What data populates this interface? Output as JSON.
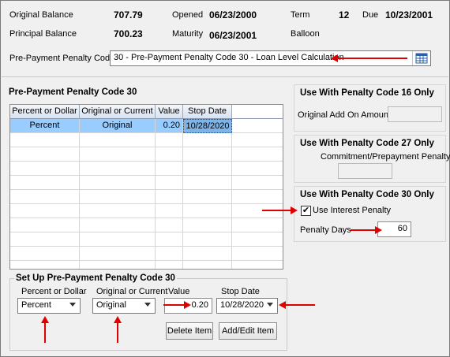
{
  "summary": {
    "original_balance_label": "Original Balance",
    "original_balance_value": "707.79",
    "principal_balance_label": "Principal Balance",
    "principal_balance_value": "700.23",
    "opened_label": "Opened",
    "opened_value": "06/23/2000",
    "maturity_label": "Maturity",
    "maturity_value": "06/23/2001",
    "term_label": "Term",
    "term_value": "12",
    "due_label": "Due",
    "due_value": "10/23/2001",
    "balloon_label": "Balloon"
  },
  "penalty_code": {
    "label": "Pre-Payment Penalty Code",
    "value": "30 - Pre-Payment Penalty Code 30 - Loan Level Calculation"
  },
  "code30_group": {
    "title": "Pre-Payment Penalty Code 30",
    "columns": [
      "Percent or Dollar",
      "Original or Current",
      "Value",
      "Stop Date"
    ],
    "rows": [
      [
        "Percent",
        "Original",
        "0.20",
        "10/28/2020"
      ]
    ]
  },
  "setup_group": {
    "title": "Set Up Pre-Payment Penalty Code 30",
    "percent_label": "Percent or Dollar",
    "percent_value": "Percent",
    "orig_label": "Original or Current",
    "orig_value": "Original",
    "value_label": "Value",
    "value_value": "0.20",
    "stop_label": "Stop Date",
    "stop_value": "10/28/2020",
    "delete_button": "Delete Item",
    "add_edit_button": "Add/Edit Item"
  },
  "code16_group": {
    "title": "Use With Penalty Code 16 Only",
    "field_label": "Original Add On Amount",
    "field_value": ""
  },
  "code27_group": {
    "title": "Use With Penalty Code 27 Only",
    "field_label": "Commitment/Prepayment Penalty",
    "field_value": ""
  },
  "code30_only_group": {
    "title": "Use With Penalty Code 30 Only",
    "checkbox_label": "Use Interest Penalty",
    "checkbox_checked": true,
    "checkmark": "✔",
    "days_label": "Penalty Days",
    "days_value": "60"
  },
  "colors": {
    "accent_arrow": "#e00000",
    "grid_selection": "#99ccff"
  }
}
